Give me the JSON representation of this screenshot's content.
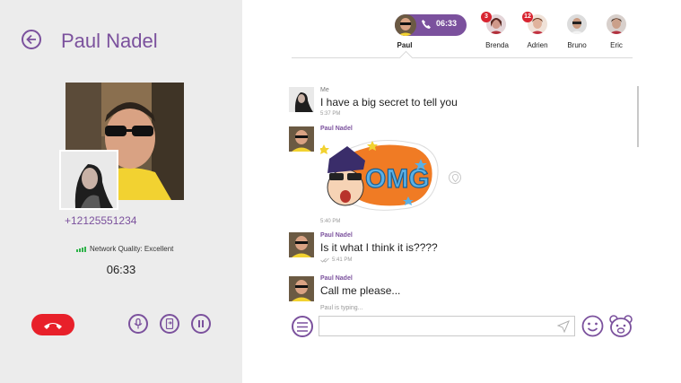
{
  "call": {
    "contact_name": "Paul Nadel",
    "phone_number": "+12125551234",
    "network_quality": "Network Quality: Excellent",
    "duration": "06:33"
  },
  "tabs": {
    "active": {
      "label": "Paul",
      "call_time": "06:33"
    },
    "others": [
      {
        "label": "Brenda",
        "badge": "3"
      },
      {
        "label": "Adrien",
        "badge": "12"
      },
      {
        "label": "Bruno",
        "badge": ""
      },
      {
        "label": "Eric",
        "badge": ""
      }
    ]
  },
  "messages": [
    {
      "sender": "Me",
      "text": "I have a big secret to tell you",
      "time": "5:37 PM"
    },
    {
      "sender": "Paul Nadel",
      "sticker": "OMG",
      "time": "5:40 PM"
    },
    {
      "sender": "Paul Nadel",
      "text": "Is it what I think it is????",
      "time": "5:41 PM"
    },
    {
      "sender": "Paul Nadel",
      "text": "Call me please..."
    }
  ],
  "composer": {
    "typing_status": "Paul is typing...",
    "placeholder": ""
  },
  "colors": {
    "accent": "#7b519d",
    "end_call": "#e8202a",
    "badge": "#d82430",
    "signal": "#2fb34a",
    "left_panel_bg": "#ececec"
  }
}
